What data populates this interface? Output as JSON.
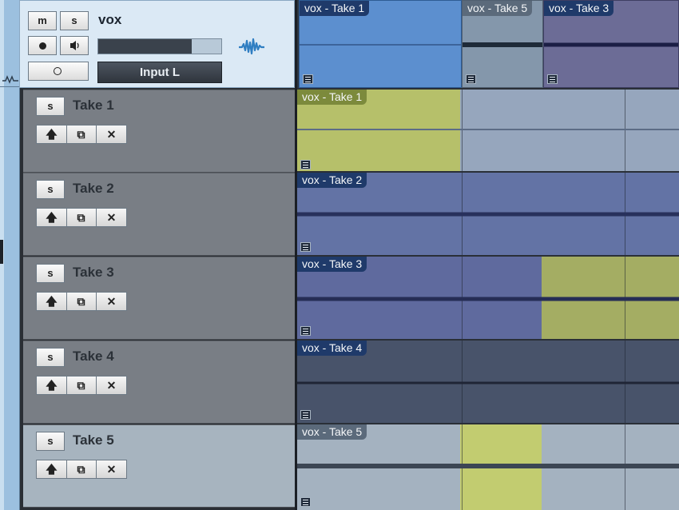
{
  "main_track": {
    "name": "vox",
    "mute_label": "m",
    "solo_label": "s",
    "input": "Input L",
    "level": 0.76,
    "colors": {
      "header_bg": "#dbe9f5",
      "meter": "#3a424c"
    },
    "icons": [
      "record-icon",
      "monitor-icon",
      "loop-icon",
      "waveform-icon"
    ]
  },
  "takes": [
    {
      "name": "Take 1",
      "solo_label": "s"
    },
    {
      "name": "Take 2",
      "solo_label": "s"
    },
    {
      "name": "Take 3",
      "solo_label": "s"
    },
    {
      "name": "Take 4",
      "solo_label": "s"
    },
    {
      "name": "Take 5",
      "solo_label": "s"
    }
  ],
  "take_buttons": {
    "promote": "🡅",
    "duplicate": "⧉",
    "delete": "✕"
  },
  "arrangement": {
    "main_clips": [
      "vox - Take 1",
      "vox - Take 5",
      "vox - Take 3"
    ],
    "take_clips": [
      "vox - Take 1",
      "vox - Take 2",
      "vox - Take 3",
      "vox - Take 4",
      "vox - Take 5"
    ],
    "colors": {
      "take1": "#96a6bd",
      "take2": "#6373a5",
      "take3": "#5f6a9e",
      "take4": "#48536a",
      "take5": "#a4b2c0",
      "selection": "#b6c06a",
      "main_clip1": "#5c8fcf",
      "main_clip2": "#8497ab",
      "main_clip3": "#6c6c96"
    }
  }
}
